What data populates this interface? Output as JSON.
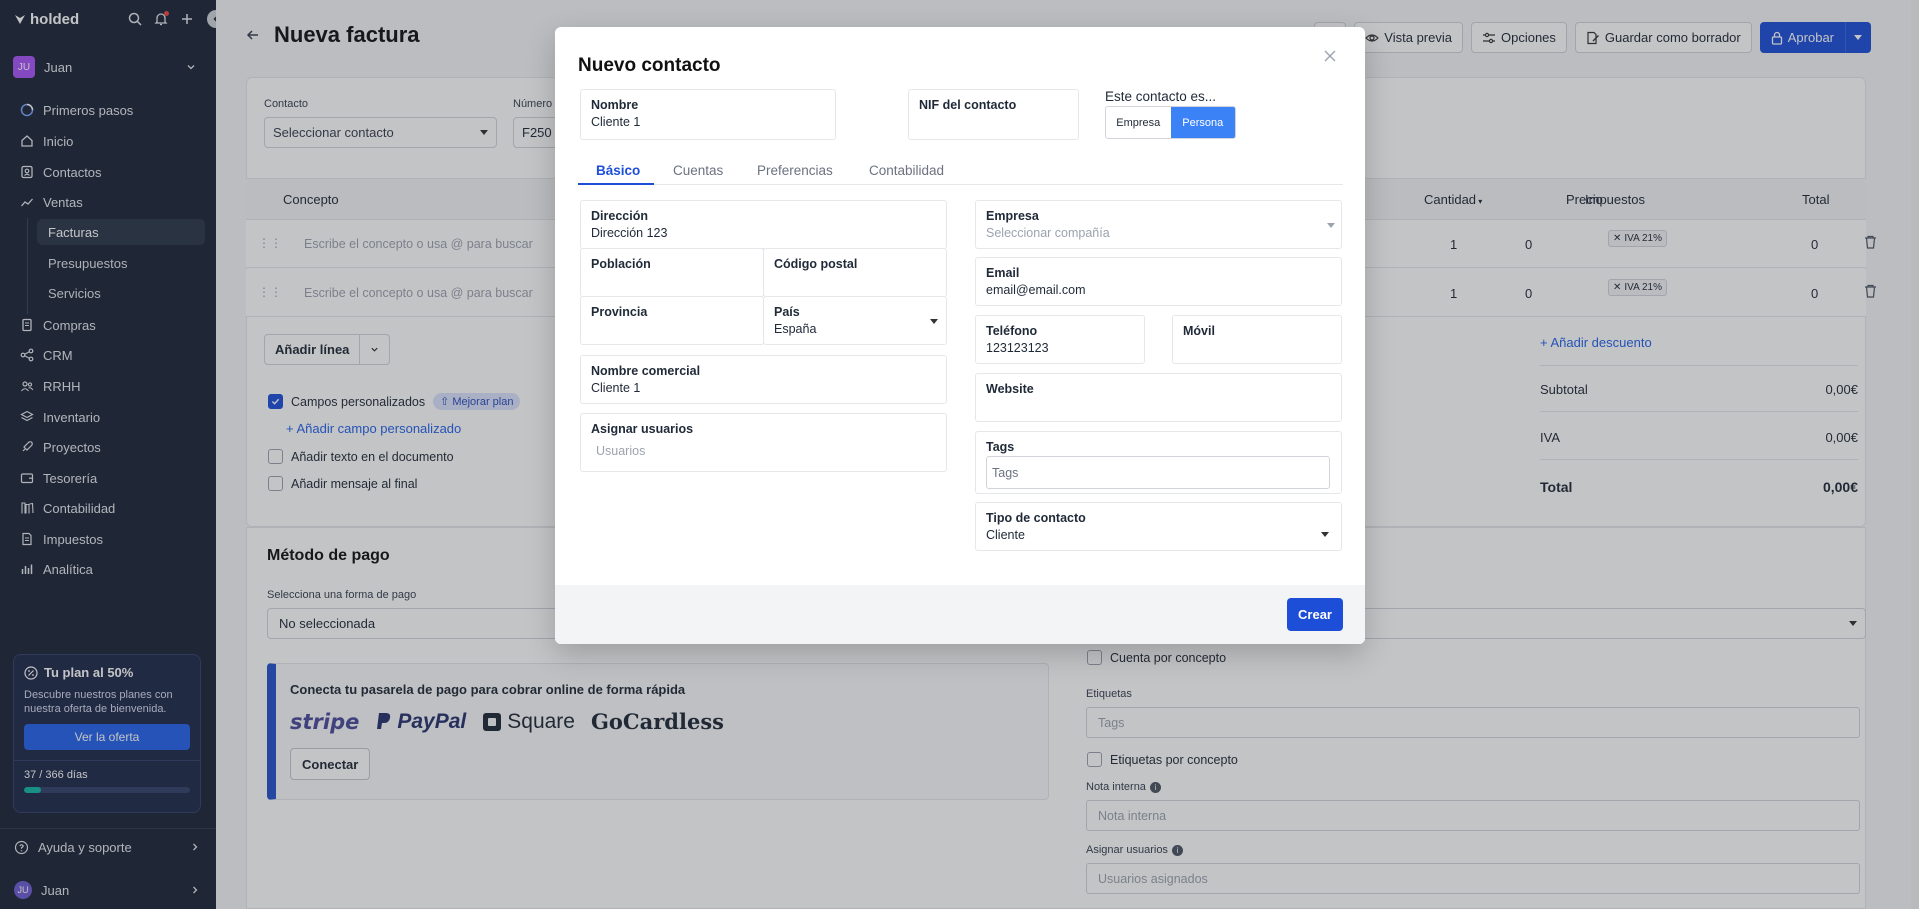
{
  "sidebar": {
    "brand": "holded",
    "user": {
      "initials": "JU",
      "name": "Juan"
    },
    "nav": [
      {
        "label": "Primeros pasos",
        "icon": "progress-icon"
      },
      {
        "label": "Inicio",
        "icon": "home-icon"
      },
      {
        "label": "Contactos",
        "icon": "contacts-icon"
      },
      {
        "label": "Ventas",
        "icon": "chart-line-icon"
      }
    ],
    "ventas_sub": [
      "Facturas",
      "Presupuestos",
      "Servicios"
    ],
    "nav2": [
      "Compras",
      "CRM",
      "RRHH",
      "Inventario",
      "Proyectos",
      "Tesorería",
      "Contabilidad",
      "Impuestos",
      "Analítica"
    ],
    "plan": {
      "title": "Tu plan al 50%",
      "text": "Descubre nuestros planes con nuestra oferta de bienvenida.",
      "button": "Ver la oferta",
      "days": "37 / 366 días",
      "progress": 0.1
    },
    "help": "Ayuda y soporte",
    "bottom_user": {
      "initials": "JU",
      "name": "Juan"
    }
  },
  "header": {
    "title": "Nueva factura",
    "buttons": {
      "preview": "Vista previa",
      "options": "Opciones",
      "draft": "Guardar como borrador",
      "approve": "Aprobar"
    }
  },
  "invoice": {
    "contact_label": "Contacto",
    "contact_value": "Seleccionar contacto",
    "number_label": "Número",
    "number_value": "F250",
    "columns": {
      "concept": "Concepto",
      "qty": "Cantidad",
      "price": "Precio",
      "taxes": "Impuestos",
      "total": "Total"
    },
    "lines": [
      {
        "placeholder": "Escribe el concepto o usa @ para buscar",
        "qty": "1",
        "price": "0",
        "tax": "IVA 21%",
        "total": "0"
      },
      {
        "placeholder": "Escribe el concepto o usa @ para buscar",
        "qty": "1",
        "price": "0",
        "tax": "IVA 21%",
        "total": "0"
      }
    ],
    "add_line": "Añadir línea",
    "custom_fields": "Campos personalizados",
    "upgrade": "Mejorar plan",
    "add_custom_field": "+ Añadir campo personalizado",
    "add_text": "Añadir texto en el documento",
    "add_message": "Añadir mensaje al final",
    "add_discount": "+ Añadir descuento",
    "totals": [
      {
        "label": "Subtotal",
        "value": "0,00€"
      },
      {
        "label": "IVA",
        "value": "0,00€"
      },
      {
        "label": "Total",
        "value": "0,00€"
      }
    ]
  },
  "payment": {
    "title": "Método de pago",
    "select_label": "Selecciona una forma de pago",
    "select_value": "No seleccionada",
    "gateway_text": "Conecta tu pasarela de pago para cobrar online de forma rápida",
    "logos": [
      "stripe",
      "PayPal",
      "Square",
      "GoCardless"
    ],
    "connect": "Conectar"
  },
  "right_panel": {
    "account_per_concept": "Cuenta por concepto",
    "tags_label": "Etiquetas",
    "tags_placeholder": "Tags",
    "tags_per_concept": "Etiquetas por concepto",
    "note_label": "Nota interna",
    "note_placeholder": "Nota interna",
    "assign_label": "Asignar usuarios",
    "assign_placeholder": "Usuarios asignados"
  },
  "modal": {
    "title": "Nuevo contacto",
    "name_label": "Nombre",
    "name_value": "Cliente 1",
    "nif_label": "NIF del contacto",
    "type_question": "Este contacto es...",
    "type_options": [
      "Empresa",
      "Persona"
    ],
    "type_selected": "Persona",
    "tabs": [
      "Básico",
      "Cuentas",
      "Preferencias",
      "Contabilidad"
    ],
    "active_tab": "Básico",
    "address_label": "Dirección",
    "address_value": "Dirección 123",
    "city_label": "Población",
    "zip_label": "Código postal",
    "province_label": "Provincia",
    "country_label": "País",
    "country_value": "España",
    "trade_name_label": "Nombre comercial",
    "trade_name_value": "Cliente 1",
    "assign_users_label": "Asignar usuarios",
    "assign_users_placeholder": "Usuarios",
    "company_label": "Empresa",
    "company_placeholder": "Seleccionar compañía",
    "email_label": "Email",
    "email_value": "email@email.com",
    "phone_label": "Teléfono",
    "phone_value": "123123123",
    "mobile_label": "Móvil",
    "website_label": "Website",
    "tags_label": "Tags",
    "tags_placeholder": "Tags",
    "contact_type_label": "Tipo de contacto",
    "contact_type_value": "Cliente",
    "create_button": "Crear"
  },
  "colors": {
    "sidebar": "#1c2536",
    "primary": "#1d4ed8",
    "toggle_active": "#3b82f6"
  }
}
